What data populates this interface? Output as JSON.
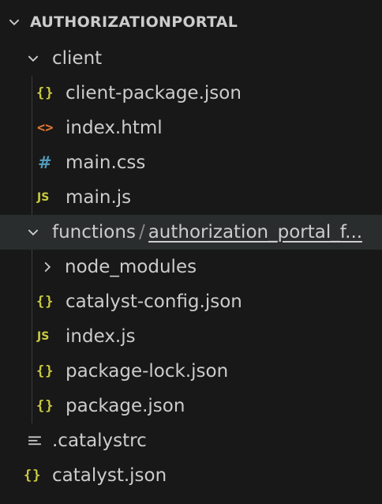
{
  "explorer": {
    "root_label": "AUTHORIZATIONPORTAL",
    "items": [
      {
        "label": "client"
      },
      {
        "label": "client-package.json",
        "icon": "json-file-icon",
        "glyph": "{}"
      },
      {
        "label": "index.html",
        "icon": "html-file-icon",
        "glyph": "<>"
      },
      {
        "label": "main.css",
        "icon": "css-file-icon",
        "glyph": "#"
      },
      {
        "label": "main.js",
        "icon": "js-file-icon",
        "glyph": "JS"
      },
      {
        "label": "functions",
        "compact_sep": "/",
        "compact_sub": "authorization_portal_f..."
      },
      {
        "label": "node_modules"
      },
      {
        "label": "catalyst-config.json",
        "icon": "json-file-icon",
        "glyph": "{}"
      },
      {
        "label": "index.js",
        "icon": "js-file-icon",
        "glyph": "JS"
      },
      {
        "label": "package-lock.json",
        "icon": "json-file-icon",
        "glyph": "{}"
      },
      {
        "label": "package.json",
        "icon": "json-file-icon",
        "glyph": "{}"
      },
      {
        "label": ".catalystrc",
        "icon": "settings-file-icon"
      },
      {
        "label": "catalyst.json",
        "icon": "json-file-icon",
        "glyph": "{}"
      }
    ],
    "colors": {
      "background": "#181818",
      "selected_row": "#2a2d2e",
      "json_icon": "#cbcb41",
      "js_icon": "#cbcb41",
      "css_icon": "#519aba",
      "html_icon": "#e37933",
      "text": "#cccccc"
    }
  }
}
